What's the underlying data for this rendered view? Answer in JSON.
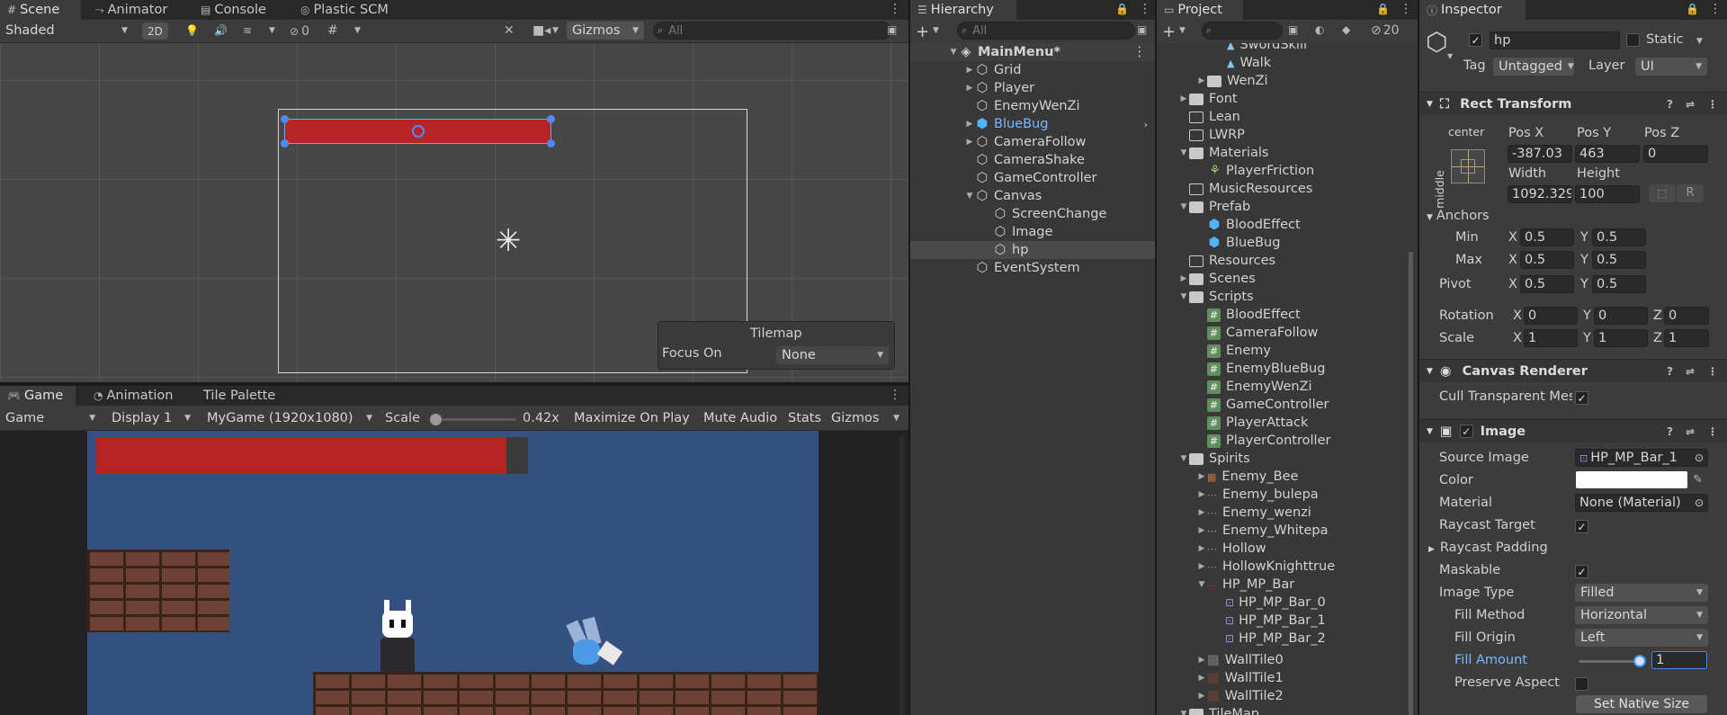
{
  "scene": {
    "tabs": [
      "Scene",
      "Animator",
      "Console",
      "Plastic SCM"
    ],
    "shading_mode": "Shaded",
    "mode_2d": "2D",
    "hidden_count": "0",
    "gizmos": "Gizmos",
    "search_placeholder": "All",
    "overlay": {
      "title": "Tilemap",
      "focus_label": "Focus On",
      "focus_value": "None"
    }
  },
  "game": {
    "tabs": [
      "Game",
      "Animation",
      "Tile Palette"
    ],
    "view_mode": "Game",
    "display": "Display 1",
    "resolution": "MyGame (1920x1080)",
    "scale_label": "Scale",
    "scale_value": "0.42x",
    "scale_fraction": 0,
    "maximize": "Maximize On Play",
    "mute": "Mute Audio",
    "stats": "Stats",
    "gizmos": "Gizmos",
    "hp_fill": 0.95
  },
  "hierarchy": {
    "tab": "Hierarchy",
    "search_placeholder": "All",
    "scene_name": "MainMenu*",
    "items": [
      "Grid",
      "Player",
      "EnemyWenZi",
      "BlueBug",
      "CameraFollow",
      "CameraShake",
      "GameController",
      "Canvas",
      "ScreenChange",
      "Image",
      "hp",
      "EventSystem"
    ]
  },
  "project": {
    "tab": "Project",
    "hidden_count": "20",
    "items": [
      "SwordSkill",
      "Walk",
      "WenZi",
      "Font",
      "Lean",
      "LWRP",
      "Materials",
      "PlayerFriction",
      "MusicResources",
      "Prefab",
      "BloodEffect",
      "BlueBug",
      "Resources",
      "Scenes",
      "Scripts",
      "BloodEffect",
      "CameraFollow",
      "Enemy",
      "EnemyBlueBug",
      "EnemyWenZi",
      "GameController",
      "PlayerAttack",
      "PlayerController",
      "Spirits",
      "Enemy_Bee",
      "Enemy_bulepa",
      "Enemy_wenzi",
      "Enemy_Whitepa",
      "Hollow",
      "HollowKnighttrue",
      "HP_MP_Bar",
      "HP_MP_Bar_0",
      "HP_MP_Bar_1",
      "HP_MP_Bar_2",
      "WallTile0",
      "WallTile1",
      "WallTile2",
      "TileMap"
    ]
  },
  "inspector": {
    "tab": "Inspector",
    "object_name": "hp",
    "static_label": "Static",
    "tag_label": "Tag",
    "tag_value": "Untagged",
    "layer_label": "Layer",
    "layer_value": "UI",
    "rect": {
      "title": "Rect Transform",
      "anchor_h": "center",
      "anchor_v": "middle",
      "pos_x_label": "Pos X",
      "pos_y_label": "Pos Y",
      "pos_z_label": "Pos Z",
      "pos_x": "-387.03",
      "pos_y": "463",
      "pos_z": "0",
      "width_label": "Width",
      "height_label": "Height",
      "width": "1092.329",
      "height": "100",
      "r_btn": "R",
      "anchors_label": "Anchors",
      "min_label": "Min",
      "max_label": "Max",
      "pivot_label": "Pivot",
      "min_x": "0.5",
      "min_y": "0.5",
      "max_x": "0.5",
      "max_y": "0.5",
      "pivot_x": "0.5",
      "pivot_y": "0.5",
      "rotation_label": "Rotation",
      "scale_label": "Scale",
      "rot_x": "0",
      "rot_y": "0",
      "rot_z": "0",
      "scale_x": "1",
      "scale_y": "1",
      "scale_z": "1",
      "x": "X",
      "y": "Y",
      "z": "Z"
    },
    "canvas_renderer": {
      "title": "Canvas Renderer",
      "cull_label": "Cull Transparent Mes"
    },
    "image": {
      "title": "Image",
      "source_label": "Source Image",
      "source_value": "HP_MP_Bar_1",
      "color_label": "Color",
      "material_label": "Material",
      "material_value": "None (Material)",
      "raycast_label": "Raycast Target",
      "raycast_padding_label": "Raycast Padding",
      "maskable_label": "Maskable",
      "image_type_label": "Image Type",
      "image_type_value": "Filled",
      "fill_method_label": "Fill Method",
      "fill_method_value": "Horizontal",
      "fill_origin_label": "Fill Origin",
      "fill_origin_value": "Left",
      "fill_amount_label": "Fill Amount",
      "fill_amount_value": "1",
      "fill_amount": 1,
      "preserve_label": "Preserve Aspect",
      "native_btn": "Set Native Size"
    }
  },
  "colors": {
    "hp_red": "#b82424",
    "game_bg": "#355181",
    "accent_blue": "#7ab7ff",
    "panel": "#383838"
  }
}
